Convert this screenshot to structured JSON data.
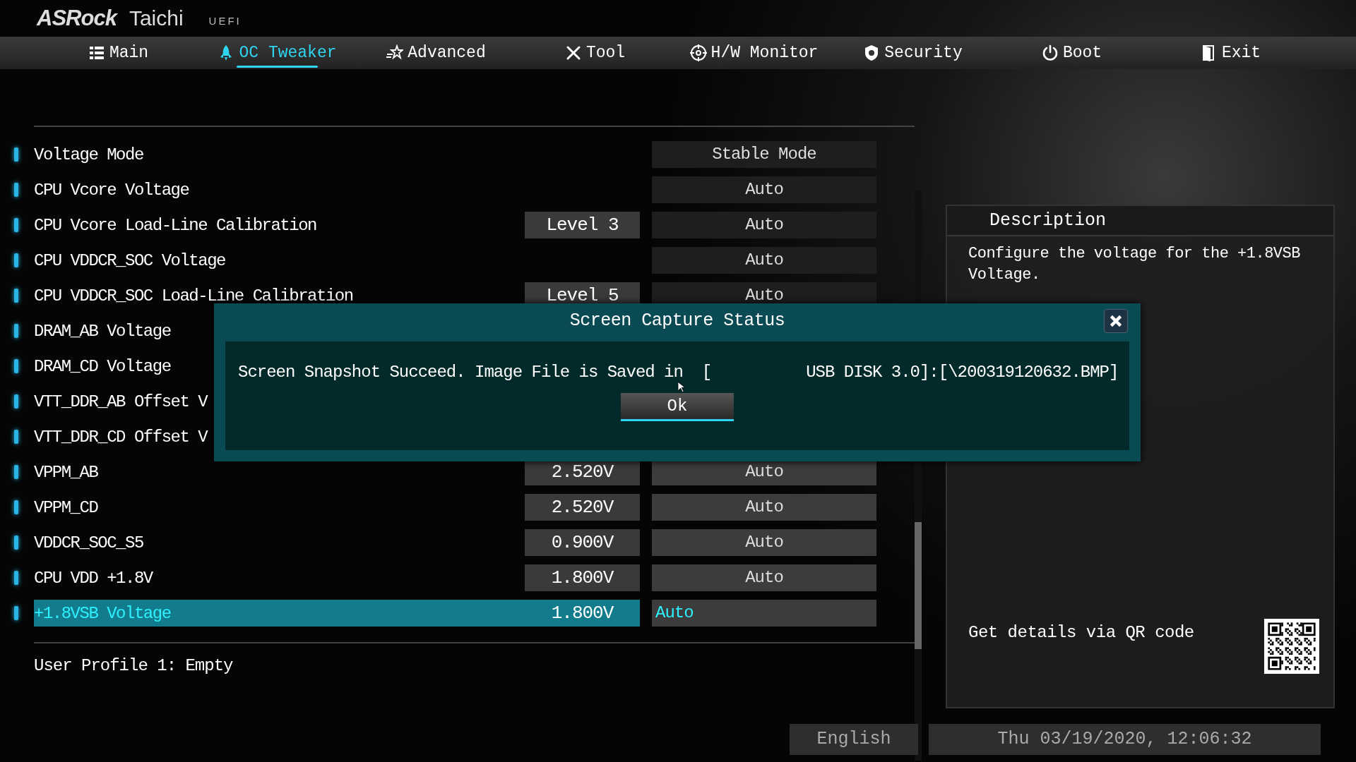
{
  "brand": {
    "name": "ASRock",
    "model": "Taichi",
    "tag": "UEFI"
  },
  "tabs": [
    {
      "label": "Main",
      "selected": false
    },
    {
      "label": "OC Tweaker",
      "selected": true
    },
    {
      "label": "Advanced",
      "selected": false
    },
    {
      "label": "Tool",
      "selected": false
    },
    {
      "label": "H/W Monitor",
      "selected": false
    },
    {
      "label": "Security",
      "selected": false
    },
    {
      "label": "Boot",
      "selected": false
    },
    {
      "label": "Exit",
      "selected": false
    }
  ],
  "settings": [
    {
      "label": "Voltage Mode",
      "setting": "Stable Mode",
      "selected": false
    },
    {
      "label": "CPU Vcore Voltage",
      "setting": "Auto",
      "selected": false
    },
    {
      "label": "CPU Vcore Load-Line Calibration",
      "value": "Level 3",
      "setting": "Auto",
      "selected": false
    },
    {
      "label": "CPU VDDCR_SOC Voltage",
      "setting": "Auto",
      "selected": false
    },
    {
      "label": "CPU VDDCR_SOC Load-Line Calibration",
      "value": "Level 5",
      "setting": "Auto",
      "selected": false
    },
    {
      "label": "DRAM_AB Voltage",
      "selected": false
    },
    {
      "label": "DRAM_CD Voltage",
      "selected": false
    },
    {
      "label": "VTT_DDR_AB Offset V",
      "selected": false
    },
    {
      "label": "VTT_DDR_CD Offset V",
      "selected": false
    },
    {
      "label": "VPPM_AB",
      "value": "2.520V",
      "setting": "Auto",
      "selected": false
    },
    {
      "label": "VPPM_CD",
      "value": "2.520V",
      "setting": "Auto",
      "selected": false
    },
    {
      "label": "VDDCR_SOC_S5",
      "value": "0.900V",
      "setting": "Auto",
      "selected": false
    },
    {
      "label": "CPU VDD +1.8V",
      "value": "1.800V",
      "setting": "Auto",
      "selected": false
    },
    {
      "label": "+1.8VSB Voltage",
      "value": "1.800V",
      "setting": "Auto",
      "selected": true
    }
  ],
  "user_profile": "User Profile 1: Empty",
  "description": {
    "title": "Description",
    "text": "Configure the voltage for the +1.8VSB Voltage.",
    "qr_label": "Get details via QR code"
  },
  "dialog": {
    "title": "Screen Capture Status",
    "message": "Screen Snapshot Succeed. Image File is Saved in  [          USB DISK 3.0]:[\\200319120632.BMP]",
    "button": "Ok"
  },
  "status_bar": {
    "language": "English",
    "datetime": "Thu 03/19/2020, 12:06:32"
  }
}
